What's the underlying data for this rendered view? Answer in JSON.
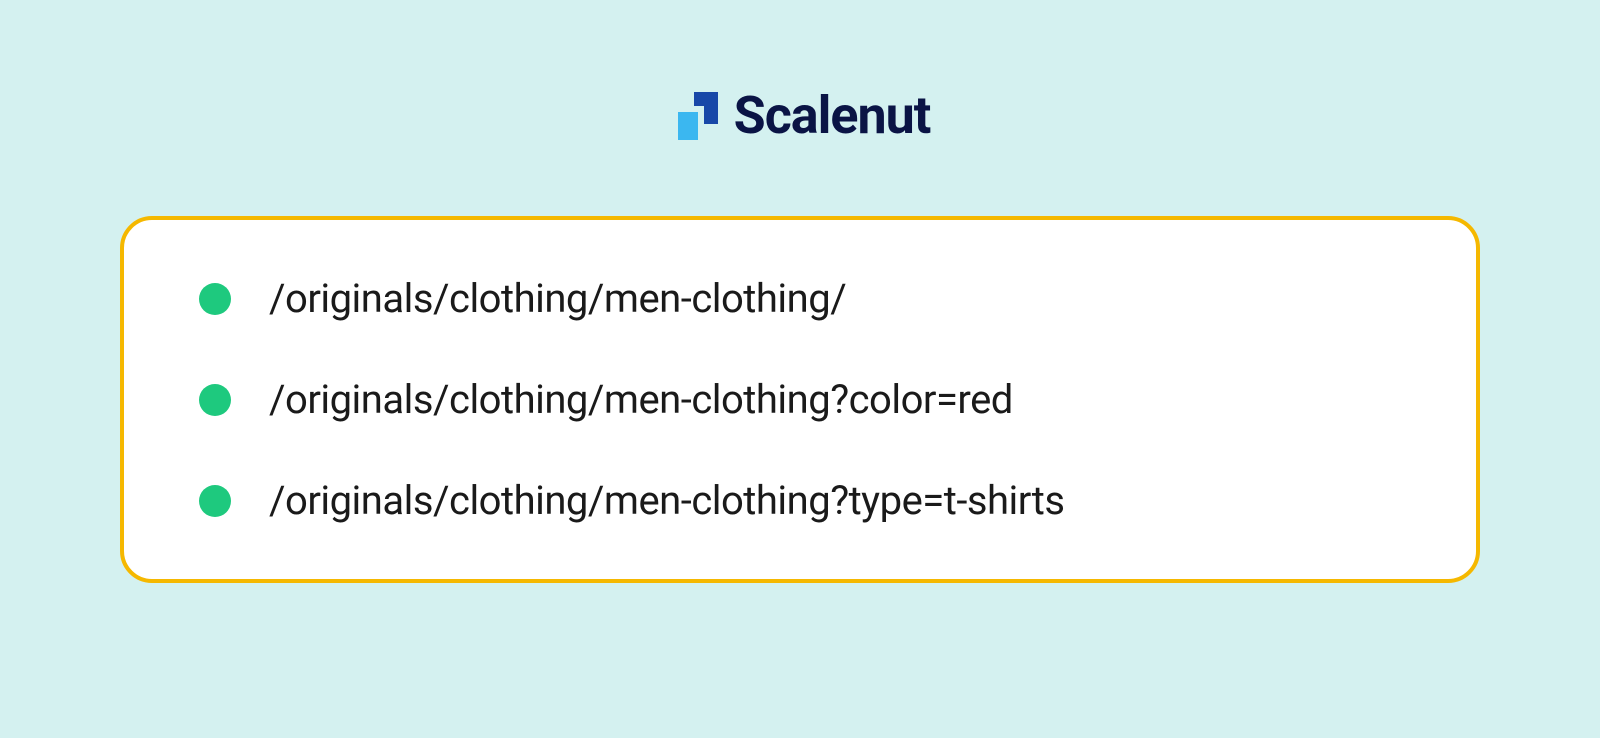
{
  "brand": {
    "name": "Scalenut",
    "logo_colors": {
      "dark_blue": "#1848a8",
      "light_blue": "#3bb7f0"
    }
  },
  "card": {
    "items": [
      "/originals/clothing/men-clothing/",
      "/originals/clothing/men-clothing?color=red",
      "/originals/clothing/men-clothing?type=t-shirts"
    ]
  },
  "colors": {
    "background": "#d4f1f0",
    "card_border": "#f5b800",
    "bullet": "#1ec97e",
    "text_primary": "#0a1445"
  }
}
